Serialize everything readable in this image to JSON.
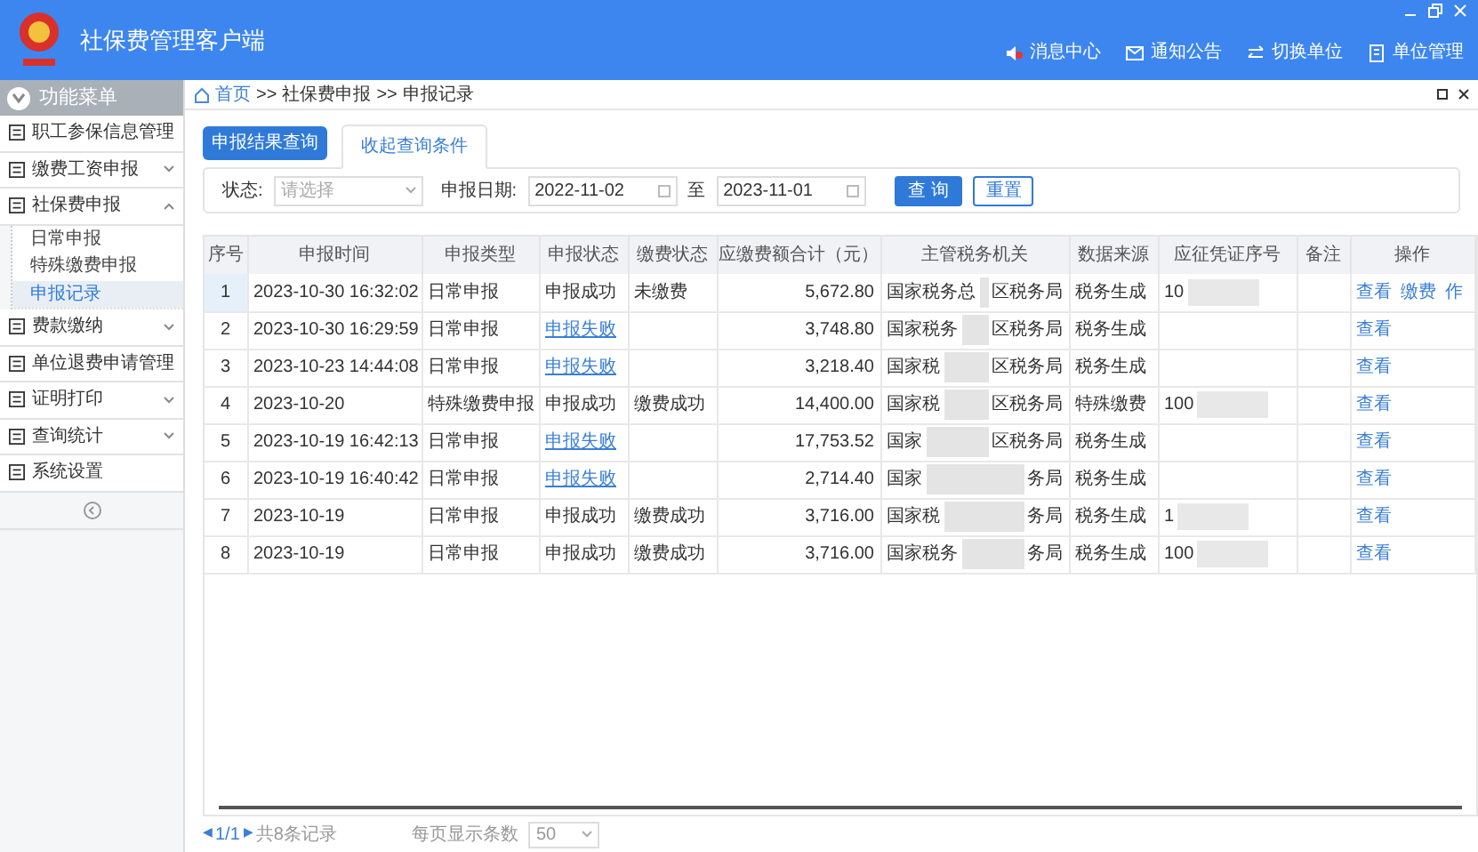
{
  "window": {
    "title": "社保费管理客户端"
  },
  "header_links": [
    {
      "label": "消息中心"
    },
    {
      "label": "通知公告"
    },
    {
      "label": "切换单位"
    },
    {
      "label": "单位管理"
    }
  ],
  "sidebar": {
    "title": "功能菜单",
    "items": [
      {
        "label": "职工参保信息管理"
      },
      {
        "label": "缴费工资申报",
        "expanded": false
      },
      {
        "label": "社保费申报",
        "expanded": true,
        "children": [
          {
            "label": "日常申报",
            "selected": false
          },
          {
            "label": "特殊缴费申报",
            "selected": false
          },
          {
            "label": "申报记录",
            "selected": true
          }
        ]
      },
      {
        "label": "费款缴纳",
        "expanded": false
      },
      {
        "label": "单位退费申请管理"
      },
      {
        "label": "证明打印",
        "expanded": false
      },
      {
        "label": "查询统计",
        "expanded": false
      },
      {
        "label": "系统设置"
      }
    ]
  },
  "breadcrumb": [
    "首页",
    ">>",
    "社保费申报",
    ">>",
    "申报记录"
  ],
  "tabs": [
    {
      "label": "申报结果查询",
      "kind": "primary"
    },
    {
      "label": "收起查询条件",
      "kind": "tab"
    }
  ],
  "filter": {
    "status_label": "状态:",
    "status_placeholder": "请选择",
    "date_label": "申报日期:",
    "date_from": "2022-11-02",
    "to_label": "至",
    "date_to": "2023-11-01",
    "query_button": "查 询",
    "reset_button": "重置"
  },
  "table": {
    "columns": [
      "序号",
      "申报时间",
      "申报类型",
      "申报状态",
      "缴费状态",
      "应缴费额合计（元）",
      "主管税务机关",
      "数据来源",
      "应征凭证序号",
      "备注",
      "操作"
    ],
    "rows": [
      {
        "no": "1",
        "time": "2023-10-30 16:32:02",
        "type": "日常申报",
        "status": "申报成功",
        "status_link": false,
        "pay_status": "未缴费",
        "amount": "5,672.80",
        "authority_start": "国家税务总",
        "authority_end": "区税务局",
        "source": "税务生成",
        "voucher": "10",
        "actions": [
          "查看",
          "缴费",
          "作"
        ],
        "selected": true
      },
      {
        "no": "2",
        "time": "2023-10-30 16:29:59",
        "type": "日常申报",
        "status": "申报失败",
        "status_link": true,
        "amount": "3,748.80",
        "authority_start": "国家税务",
        "authority_end": "区税务局",
        "source": "税务生成",
        "actions": [
          "查看"
        ],
        "selected": false
      },
      {
        "no": "3",
        "time": "2023-10-23 14:44:08",
        "type": "日常申报",
        "status": "申报失败",
        "status_link": true,
        "amount": "3,218.40",
        "authority_start": "国家税",
        "authority_end": "区税务局",
        "source": "税务生成",
        "actions": [
          "查看"
        ],
        "selected": false
      },
      {
        "no": "4",
        "time": "2023-10-20",
        "type": "特殊缴费申报",
        "status": "申报成功",
        "status_link": false,
        "pay_status": "缴费成功",
        "amount": "14,400.00",
        "authority_start": "国家税",
        "authority_end": "区税务局",
        "source": "特殊缴费",
        "voucher": "100",
        "actions": [
          "查看"
        ],
        "selected": false
      },
      {
        "no": "5",
        "time": "2023-10-19 16:42:13",
        "type": "日常申报",
        "status": "申报失败",
        "status_link": true,
        "amount": "17,753.52",
        "authority_start": "国家",
        "authority_end": "区税务局",
        "source": "税务生成",
        "actions": [
          "查看"
        ],
        "selected": false
      },
      {
        "no": "6",
        "time": "2023-10-19 16:40:42",
        "type": "日常申报",
        "status": "申报失败",
        "status_link": true,
        "amount": "2,714.40",
        "authority_start": "国家",
        "authority_end": "务局",
        "source": "税务生成",
        "actions": [
          "查看"
        ],
        "selected": false
      },
      {
        "no": "7",
        "time": "2023-10-19",
        "type": "日常申报",
        "status": "申报成功",
        "status_link": false,
        "pay_status": "缴费成功",
        "amount": "3,716.00",
        "authority_start": "国家税",
        "authority_end": "务局",
        "source": "税务生成",
        "voucher": "1",
        "actions": [
          "查看"
        ],
        "selected": false
      },
      {
        "no": "8",
        "time": "2023-10-19",
        "type": "日常申报",
        "status": "申报成功",
        "status_link": false,
        "pay_status": "缴费成功",
        "amount": "3,716.00",
        "authority_start": "国家税务",
        "authority_end": "务局",
        "source": "税务生成",
        "voucher": "100",
        "actions": [
          "查看"
        ],
        "selected": false
      }
    ]
  },
  "pagination": {
    "prev": "◀",
    "page": "1/1",
    "next": "▶",
    "total": "共8条记录",
    "page_size_label": "每页显示条数",
    "page_size": "50"
  }
}
